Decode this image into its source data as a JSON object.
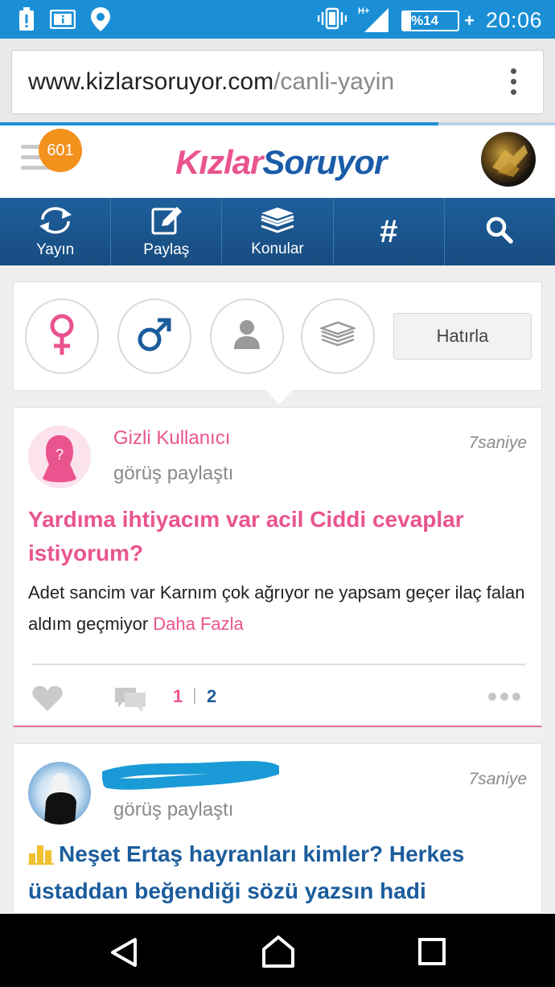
{
  "status_bar": {
    "time": "20:06",
    "battery": "%14",
    "battery_plus": "+",
    "network": "H+",
    "icons": [
      "battery-alert-icon",
      "info-card-icon",
      "location-pin-icon",
      "vibrate-icon",
      "signal-icon",
      "battery-icon"
    ]
  },
  "browser": {
    "url_domain": "www.kizlarsoruyor.com",
    "url_path": "/canli-yayin",
    "page_load_progress": 0.79
  },
  "header": {
    "notification_count": "601",
    "logo_part1": "Kızlar",
    "logo_part2": "S",
    "logo_part3": "oruyor"
  },
  "nav": {
    "items": [
      {
        "label": "Yayın",
        "icon": "refresh-icon"
      },
      {
        "label": "Paylaş",
        "icon": "edit-icon"
      },
      {
        "label": "Konular",
        "icon": "stack-icon"
      },
      {
        "label": "#",
        "icon": "hashtag-icon"
      },
      {
        "label": "",
        "icon": "search-icon"
      }
    ]
  },
  "filters": {
    "icons": [
      "female-icon",
      "male-icon",
      "person-icon",
      "stack-icon"
    ],
    "remember_button": "Hatırla"
  },
  "posts": [
    {
      "user": "Gizli Kullanıcı",
      "action": "görüş paylaştı",
      "time": "7saniye",
      "title": "Yardıma ihtiyacım var acil Ciddi cevaplar istiyorum?",
      "body": "Adet sancim var Karnım çok ağrıyor ne yapsam geçer ilaç falan aldım geçmiyor",
      "more": "Daha Fazla",
      "count_a": "1",
      "separator": "|",
      "count_b": "2"
    },
    {
      "user": "",
      "action": "görüş paylaştı",
      "time": "7saniye",
      "title": "Neşet Ertaş hayranları kimler? Herkes üstaddan beğendiği sözü yazsın hadi"
    }
  ],
  "colors": {
    "status_bar": "#1a8fd6",
    "nav_bar": "#1e5f9c",
    "pink": "#e9548e",
    "blue": "#1b5c9c",
    "badge": "#f3911d"
  }
}
